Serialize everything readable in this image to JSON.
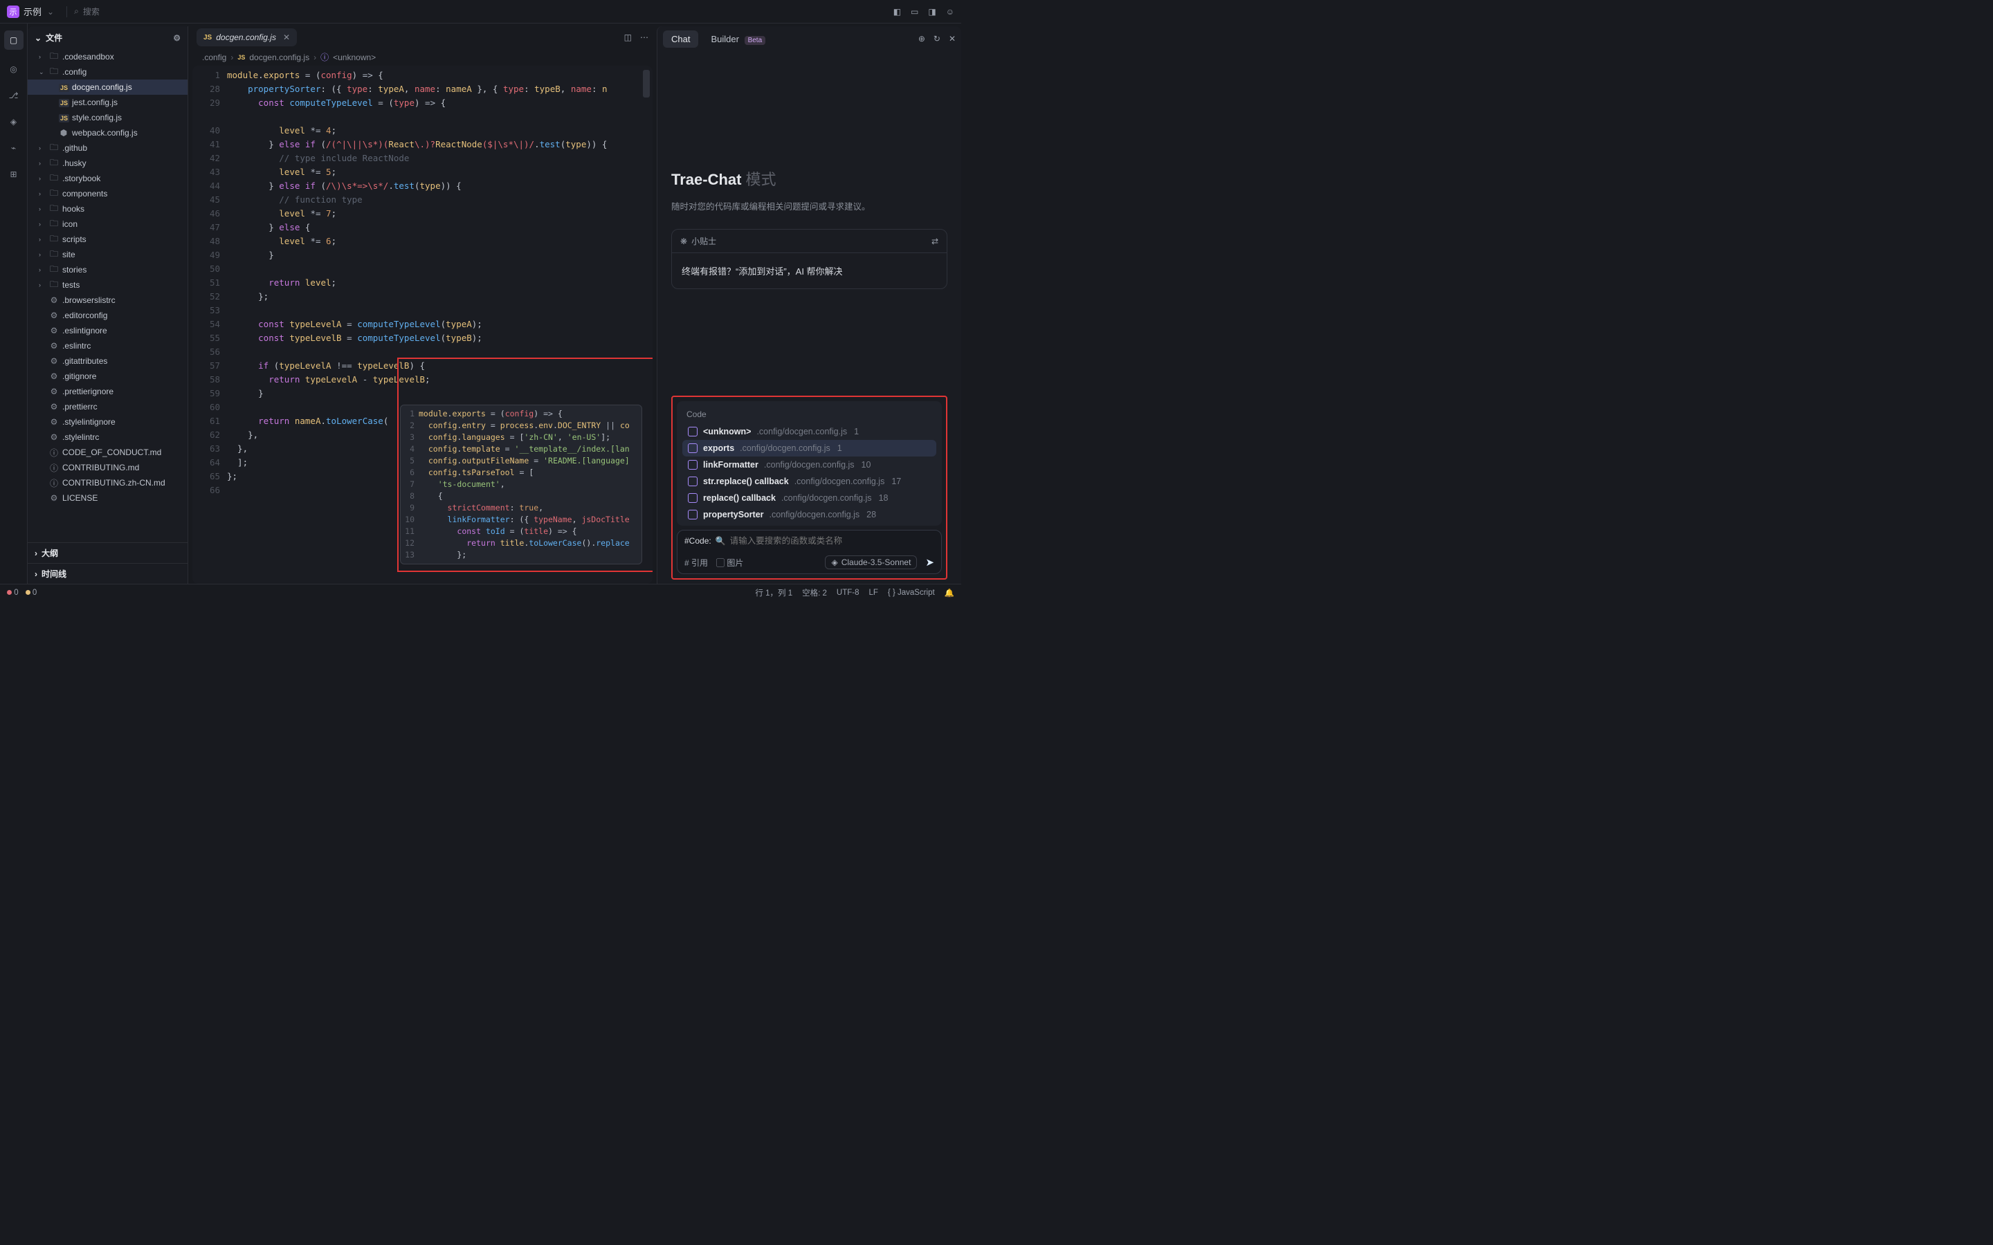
{
  "titlebar": {
    "appBadge": "示",
    "title": "示例",
    "searchPlaceholder": "搜索"
  },
  "sidebar": {
    "header": "文件",
    "sections": {
      "outline": "大纲",
      "timeline": "时间线"
    },
    "tree": [
      {
        "name": ".codesandbox",
        "depth": 1,
        "kind": "folder",
        "expanded": false
      },
      {
        "name": ".config",
        "depth": 1,
        "kind": "folder",
        "expanded": true
      },
      {
        "name": "docgen.config.js",
        "depth": 2,
        "kind": "js",
        "selected": true
      },
      {
        "name": "jest.config.js",
        "depth": 2,
        "kind": "js"
      },
      {
        "name": "style.config.js",
        "depth": 2,
        "kind": "js"
      },
      {
        "name": "webpack.config.js",
        "depth": 2,
        "kind": "webpack"
      },
      {
        "name": ".github",
        "depth": 1,
        "kind": "folder",
        "expanded": false
      },
      {
        "name": ".husky",
        "depth": 1,
        "kind": "folder",
        "expanded": false
      },
      {
        "name": ".storybook",
        "depth": 1,
        "kind": "folder",
        "expanded": false
      },
      {
        "name": "components",
        "depth": 1,
        "kind": "folder",
        "expanded": false
      },
      {
        "name": "hooks",
        "depth": 1,
        "kind": "folder",
        "expanded": false
      },
      {
        "name": "icon",
        "depth": 1,
        "kind": "folder",
        "expanded": false
      },
      {
        "name": "scripts",
        "depth": 1,
        "kind": "folder",
        "expanded": false
      },
      {
        "name": "site",
        "depth": 1,
        "kind": "folder",
        "expanded": false
      },
      {
        "name": "stories",
        "depth": 1,
        "kind": "folder",
        "expanded": false
      },
      {
        "name": "tests",
        "depth": 1,
        "kind": "folder",
        "expanded": false
      },
      {
        "name": ".browserslistrc",
        "depth": 1,
        "kind": "file"
      },
      {
        "name": ".editorconfig",
        "depth": 1,
        "kind": "file"
      },
      {
        "name": ".eslintignore",
        "depth": 1,
        "kind": "file"
      },
      {
        "name": ".eslintrc",
        "depth": 1,
        "kind": "file"
      },
      {
        "name": ".gitattributes",
        "depth": 1,
        "kind": "file"
      },
      {
        "name": ".gitignore",
        "depth": 1,
        "kind": "file"
      },
      {
        "name": ".prettierignore",
        "depth": 1,
        "kind": "file"
      },
      {
        "name": ".prettierrc",
        "depth": 1,
        "kind": "file"
      },
      {
        "name": ".stylelintignore",
        "depth": 1,
        "kind": "file"
      },
      {
        "name": ".stylelintrc",
        "depth": 1,
        "kind": "file"
      },
      {
        "name": "CODE_OF_CONDUCT.md",
        "depth": 1,
        "kind": "md"
      },
      {
        "name": "CONTRIBUTING.md",
        "depth": 1,
        "kind": "md"
      },
      {
        "name": "CONTRIBUTING.zh-CN.md",
        "depth": 1,
        "kind": "md"
      },
      {
        "name": "LICENSE",
        "depth": 1,
        "kind": "file"
      }
    ]
  },
  "editor": {
    "tabLabel": "docgen.config.js",
    "breadcrumb": {
      "a": ".config",
      "b": "docgen.config.js",
      "c": "<unknown>"
    },
    "gutterStart": 1,
    "lineNumbers": [
      1,
      28,
      29,
      "",
      40,
      41,
      42,
      43,
      44,
      45,
      46,
      47,
      48,
      49,
      50,
      51,
      52,
      53,
      54,
      55,
      56,
      57,
      58,
      59,
      60,
      61,
      62,
      63,
      64,
      65,
      66
    ]
  },
  "hover": {
    "lines": 13
  },
  "chat": {
    "tabs": {
      "chat": "Chat",
      "builder": "Builder",
      "beta": "Beta"
    },
    "title": "Trae-Chat",
    "mode": "模式",
    "desc": "随时对您的代码库或编程相关问题提问或寻求建议。",
    "tipHeader": "小贴士",
    "tipBody": "终端有报错？“添加到对话”，AI 帮你解决",
    "sug": {
      "title": "Code",
      "items": [
        {
          "name": "<unknown>",
          "path": ".config/docgen.config.js",
          "line": "1"
        },
        {
          "name": "exports",
          "path": ".config/docgen.config.js",
          "line": "1",
          "selected": true
        },
        {
          "name": "linkFormatter",
          "path": ".config/docgen.config.js",
          "line": "10"
        },
        {
          "name": "str.replace() callback",
          "path": ".config/docgen.config.js",
          "line": "17"
        },
        {
          "name": "replace() callback",
          "path": ".config/docgen.config.js",
          "line": "18"
        },
        {
          "name": "propertySorter",
          "path": ".config/docgen.config.js",
          "line": "28"
        }
      ]
    },
    "input": {
      "prefix": "#Code:",
      "placeholder": "请输入要搜索的函数或类名称",
      "ref": "引用",
      "img": "图片",
      "model": "Claude-3.5-Sonnet"
    }
  },
  "status": {
    "err": "0",
    "warn": "0",
    "pos": "行 1，列 1",
    "spaces": "空格: 2",
    "enc": "UTF-8",
    "eol": "LF",
    "lang": "JavaScript"
  }
}
